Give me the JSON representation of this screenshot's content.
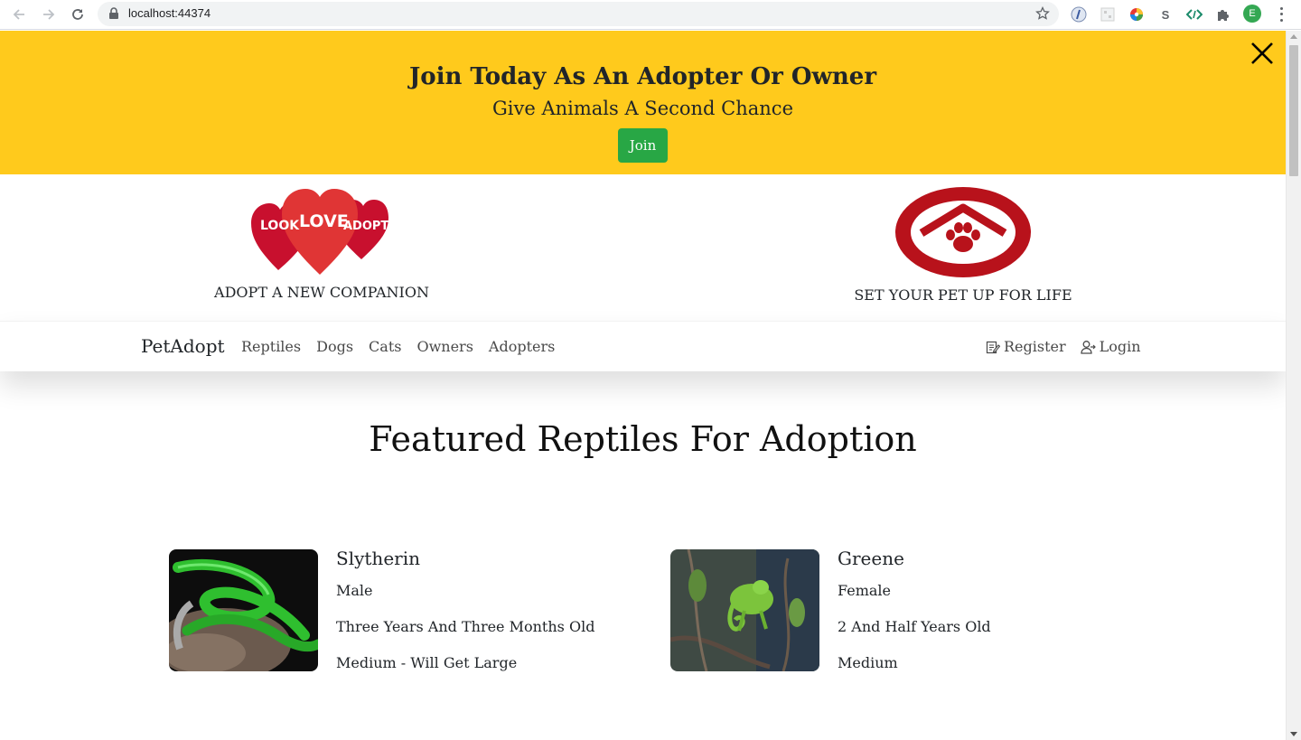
{
  "browser": {
    "url": "localhost:44374",
    "profile_initial": "E",
    "extensions": [
      "ext-1-icon",
      "ext-2-icon",
      "color-wheel-icon",
      "s-extension",
      "code-icon",
      "puzzle-icon"
    ],
    "s_extension_label": "S"
  },
  "banner": {
    "title": "Join Today As An Adopter Or Owner",
    "subtitle": "Give Animals A Second Chance",
    "join_label": "Join",
    "background": "#ffca1c",
    "button_color": "#28a745"
  },
  "logos": {
    "left": {
      "look": "LOOK",
      "love": "LOVE",
      "adopt": "ADOPT",
      "caption": "ADOPT A NEW COMPANION"
    },
    "right": {
      "caption": "SET YOUR PET UP FOR LIFE"
    }
  },
  "navbar": {
    "brand": "PetAdopt",
    "links": [
      "Reptiles",
      "Dogs",
      "Cats",
      "Owners",
      "Adopters"
    ],
    "register": "Register",
    "login": "Login"
  },
  "main": {
    "title": "Featured Reptiles For Adoption",
    "pets": [
      {
        "name": "Slytherin",
        "sex": "Male",
        "age": "Three Years And Three Months Old",
        "size": "Medium - Will Get Large"
      },
      {
        "name": "Greene",
        "sex": "Female",
        "age": "2 And Half Years Old",
        "size": "Medium"
      }
    ]
  }
}
